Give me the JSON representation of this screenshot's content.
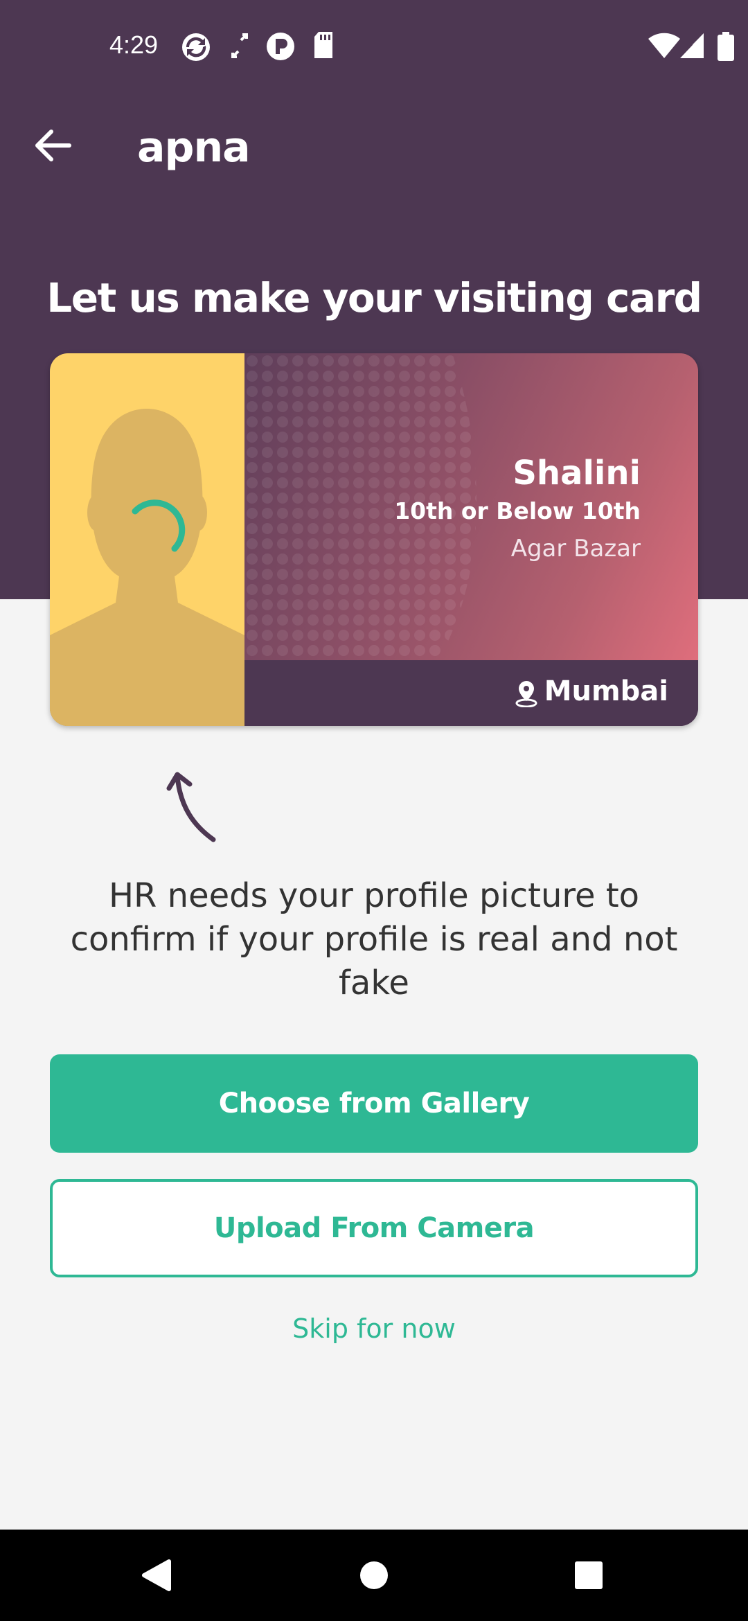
{
  "status_bar": {
    "time": "4:29",
    "icons": [
      "sync-icon",
      "screen-rotate-icon",
      "pocket-icon",
      "sd-card-icon",
      "wifi-icon",
      "cellular-signal-icon",
      "battery-icon"
    ]
  },
  "app_bar": {
    "back_icon": "arrow-left-icon",
    "title": "apna"
  },
  "heading": "Let us make your visiting card",
  "card": {
    "name": "Shalini",
    "education": "10th or Below 10th",
    "area": "Agar Bazar",
    "city": "Mumbai",
    "location_icon": "location-pin-icon",
    "avatar_icon": "person-silhouette-icon",
    "loading_icon": "spinner-icon"
  },
  "info_text": "HR needs your profile picture to confirm if your profile is real and not fake",
  "buttons": {
    "gallery": "Choose from Gallery",
    "camera": "Upload From Camera",
    "skip": "Skip for now"
  },
  "colors": {
    "header": "#4d3752",
    "accent": "#2eb894",
    "photo_bg": "#fed369",
    "card_gradient_end": "#df6e7c"
  },
  "nav_bar": {
    "icons": [
      "back-triangle-icon",
      "home-circle-icon",
      "recents-square-icon"
    ]
  }
}
